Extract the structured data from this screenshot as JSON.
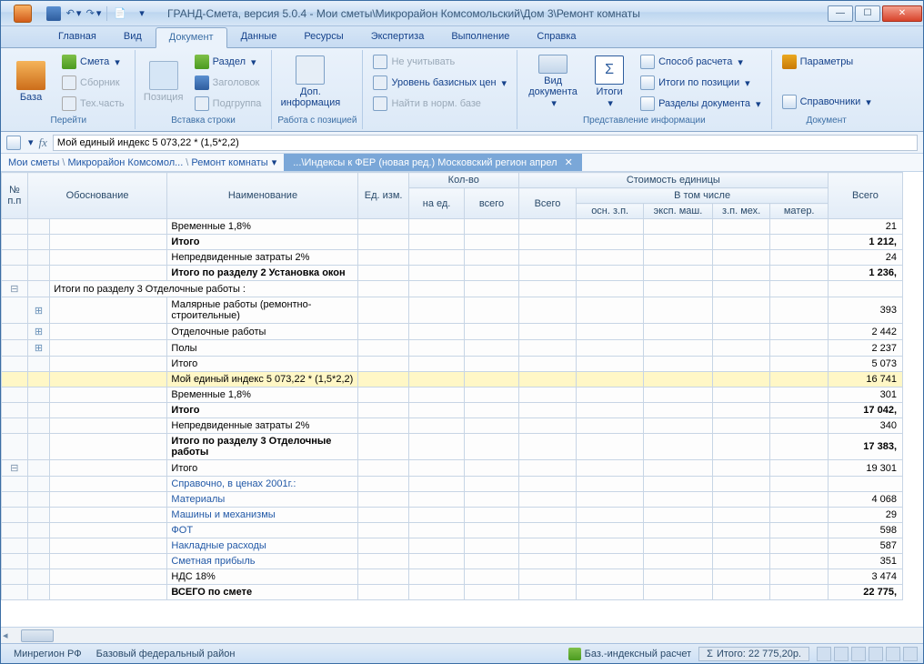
{
  "window": {
    "title": "ГРАНД-Смета, версия 5.0.4 - Мои сметы\\Микрорайон Комсомольский\\Дом 3\\Ремонт комнаты"
  },
  "tabs": {
    "items": [
      "Главная",
      "Вид",
      "Документ",
      "Данные",
      "Ресурсы",
      "Экспертиза",
      "Выполнение",
      "Справка"
    ],
    "active_index": 2
  },
  "ribbon": {
    "groups": {
      "goto": {
        "label": "Перейти",
        "base": "База",
        "smeta": "Смета",
        "sbornik": "Сборник",
        "tech": "Тех.часть"
      },
      "insert": {
        "label": "Вставка строки",
        "position": "Позиция",
        "section": "Раздел",
        "header": "Заголовок",
        "subgroup": "Подгруппа"
      },
      "info": {
        "dop_info": "Доп.\nинформация"
      },
      "workpos": {
        "label": "Работа с позицией",
        "ignore": "Не учитывать",
        "base_level": "Уровень базисных цен",
        "find_norm": "Найти в норм. базе"
      },
      "present": {
        "label": "Представление информации",
        "view_doc": "Вид\nдокумента",
        "itogi": "Итоги",
        "way_calc": "Способ расчета",
        "itogi_pos": "Итоги по позиции",
        "sections_doc": "Разделы документа"
      },
      "doc": {
        "label": "Документ",
        "params": "Параметры",
        "refs": "Справочники"
      }
    }
  },
  "formula": {
    "fx": "fx",
    "value": "Мой единый индекс 5 073,22 * (1,5*2,2)"
  },
  "breadcrumb": {
    "p1": "Мои сметы",
    "p2": "Микрорайон Комсомол...",
    "p3": "Ремонт комнаты",
    "active_tab": "...\\Индексы к ФЕР (новая ред.) Московский регион апрел"
  },
  "columns": {
    "num": "№\nп.п",
    "obs": "Обоснование",
    "name": "Наименование",
    "ed": "Ед. изм.",
    "kol": "Кол-во",
    "kol_ed": "на ед.",
    "kol_all": "всего",
    "unit_cost": "Стоимость единицы",
    "vsego": "Всего",
    "incl": "В том числе",
    "osn": "осн. з.п.",
    "eksp": "эксп. маш.",
    "zpmech": "з.п. мех.",
    "mater": "матер.",
    "total": "Всего"
  },
  "rows": [
    {
      "tree": "",
      "exp": "",
      "name": "Временные 1,8%",
      "total": "21",
      "bold": false
    },
    {
      "tree": "",
      "exp": "",
      "name": "Итого",
      "total": "1 212,",
      "bold": true
    },
    {
      "tree": "",
      "exp": "",
      "name": "Непредвиденные затраты 2%",
      "total": "24",
      "bold": false
    },
    {
      "tree": "",
      "exp": "",
      "name": "Итого по разделу 2 Установка окон",
      "total": "1 236,",
      "bold": true
    },
    {
      "tree": "⊟",
      "exp": "",
      "name": "Итоги по разделу 3 Отделочные работы :",
      "total": "",
      "bold": false,
      "name_in_obs": true
    },
    {
      "tree": "",
      "exp": "⊞",
      "name": "Малярные работы (ремонтно-строительные)",
      "total": "393",
      "bold": false
    },
    {
      "tree": "",
      "exp": "⊞",
      "name": "Отделочные работы",
      "total": "2 442",
      "bold": false
    },
    {
      "tree": "",
      "exp": "⊞",
      "name": "Полы",
      "total": "2 237",
      "bold": false
    },
    {
      "tree": "",
      "exp": "",
      "name": "Итого",
      "total": "5 073",
      "bold": false
    },
    {
      "tree": "",
      "exp": "",
      "name": "Мой единый индекс 5 073,22 * (1,5*2,2)",
      "total": "16 741",
      "bold": false,
      "highlight": true
    },
    {
      "tree": "",
      "exp": "",
      "name": "Временные 1,8%",
      "total": "301",
      "bold": false
    },
    {
      "tree": "",
      "exp": "",
      "name": "Итого",
      "total": "17 042,",
      "bold": true
    },
    {
      "tree": "",
      "exp": "",
      "name": "Непредвиденные затраты 2%",
      "total": "340",
      "bold": false
    },
    {
      "tree": "",
      "exp": "",
      "name": "Итого по разделу 3 Отделочные работы",
      "total": "17 383,",
      "bold": true
    },
    {
      "tree": "⊟",
      "exp": "",
      "name": "Итого",
      "total": "19 301",
      "bold": false
    },
    {
      "tree": "",
      "exp": "",
      "name": "Справочно, в ценах 2001г.:",
      "total": "",
      "bold": false,
      "link": true
    },
    {
      "tree": "",
      "exp": "",
      "name": "    Материалы",
      "total": "4 068",
      "bold": false,
      "link": true
    },
    {
      "tree": "",
      "exp": "",
      "name": "    Машины и механизмы",
      "total": "29",
      "bold": false,
      "link": true
    },
    {
      "tree": "",
      "exp": "",
      "name": "    ФОТ",
      "total": "598",
      "bold": false,
      "link": true
    },
    {
      "tree": "",
      "exp": "",
      "name": "    Накладные расходы",
      "total": "587",
      "bold": false,
      "link": true
    },
    {
      "tree": "",
      "exp": "",
      "name": "    Сметная прибыль",
      "total": "351",
      "bold": false,
      "link": true
    },
    {
      "tree": "",
      "exp": "",
      "name": "НДС 18%",
      "total": "3 474",
      "bold": false
    },
    {
      "tree": "",
      "exp": "",
      "name": "ВСЕГО по смете",
      "total": "22 775,",
      "bold": true
    }
  ],
  "status": {
    "minregion": "Минрегион РФ",
    "base_fed": "Базовый федеральный район",
    "calc_type": "Баз.-индексный расчет",
    "itogo_label": "Итого: 22 775,20р.",
    "sigma": "Σ"
  }
}
